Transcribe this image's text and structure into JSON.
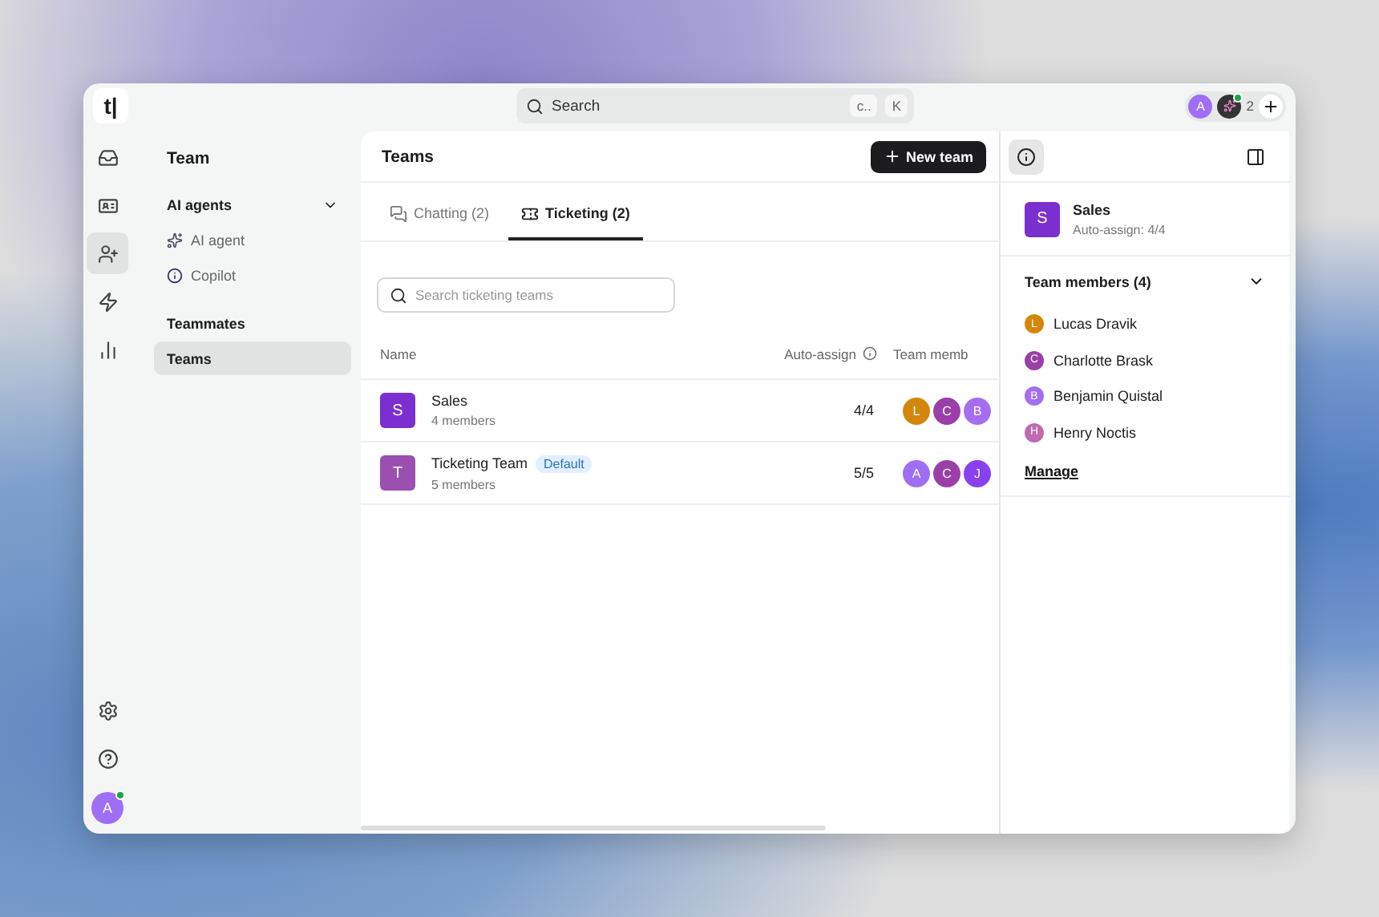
{
  "logo": "t|",
  "search": {
    "placeholder": "Search",
    "keys": [
      "c..",
      "K"
    ]
  },
  "presence": {
    "avatar": "A",
    "count": "2"
  },
  "rail": [
    {
      "selected": false
    },
    {
      "selected": false
    },
    {
      "selected": true
    },
    {
      "selected": false
    },
    {
      "selected": false
    }
  ],
  "user": {
    "initial": "A",
    "online": true
  },
  "nav": {
    "title": "Team",
    "sections": [
      {
        "title": "AI agents",
        "expanded": true,
        "items": [
          {
            "label": "AI agent",
            "selected": false
          },
          {
            "label": "Copilot",
            "selected": false
          }
        ]
      },
      {
        "title": "Teammates",
        "items": [
          {
            "label": "Teams",
            "selected": true
          }
        ]
      }
    ]
  },
  "main": {
    "title": "Teams",
    "button": "New team",
    "tabs": [
      {
        "label": "Chatting (2)",
        "selected": false
      },
      {
        "label": "Ticketing (2)",
        "selected": true
      }
    ],
    "filter": {
      "placeholder": "Search ticketing teams"
    },
    "columns": [
      "Name",
      "Auto-assign",
      "Team memb"
    ],
    "rows": [
      {
        "initial": "S",
        "color": "#7b2fd0",
        "name": "Sales",
        "badge": null,
        "members": "4 members",
        "auto": "4/4",
        "avatars": [
          {
            "initial": "L",
            "color": "#d4860b"
          },
          {
            "initial": "C",
            "color": "#9b3fa8"
          },
          {
            "initial": "B",
            "color": "#a56ef0"
          }
        ]
      },
      {
        "initial": "T",
        "color": "#9b4fb0",
        "name": "Ticketing Team",
        "badge": "Default",
        "members": "5 members",
        "auto": "5/5",
        "avatars": [
          {
            "initial": "A",
            "color": "#a06ef5"
          },
          {
            "initial": "C",
            "color": "#9b3fa8"
          },
          {
            "initial": "J",
            "color": "#8a3ff0"
          }
        ]
      }
    ]
  },
  "detail": {
    "initial": "S",
    "color": "#7b2fd0",
    "name": "Sales",
    "sub": "Auto-assign: 4/4",
    "members_title": "Team members (4)",
    "expanded": true,
    "members": [
      {
        "initial": "L",
        "name": "Lucas Dravik",
        "color": "#d4860b"
      },
      {
        "initial": "C",
        "name": "Charlotte Brask",
        "color": "#9b3fa8"
      },
      {
        "initial": "B",
        "name": "Benjamin Quistal",
        "color": "#a56ef0"
      },
      {
        "initial": "H",
        "name": "Henry Noctis",
        "color": "#c06ab0"
      }
    ],
    "link": "Manage"
  }
}
